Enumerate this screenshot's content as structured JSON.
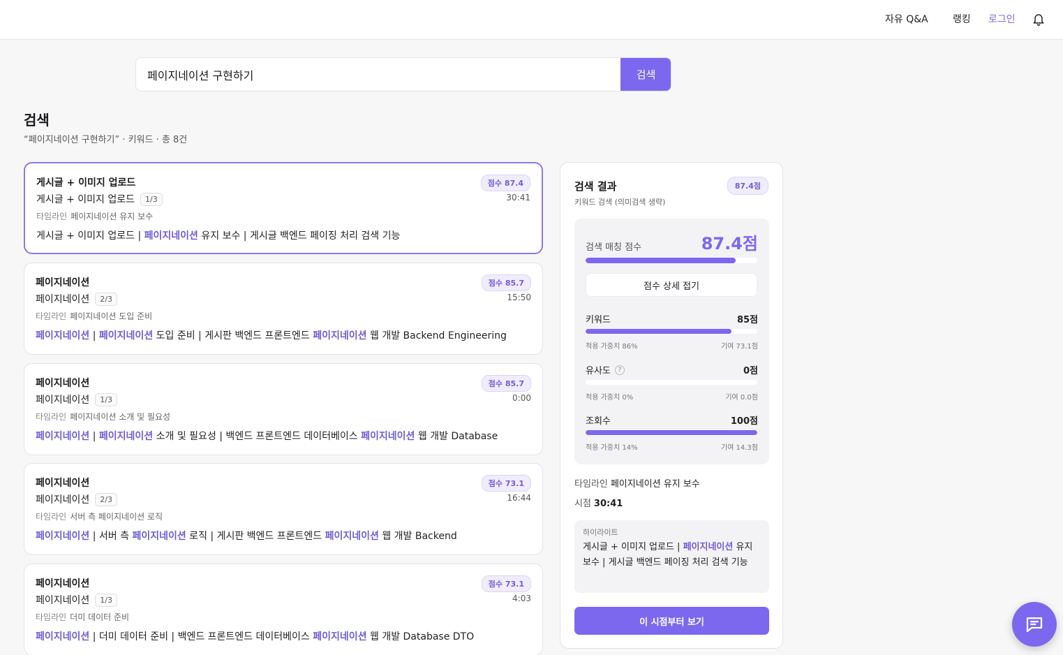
{
  "nav": {
    "items": [
      "자유 Q&A",
      "랭킹",
      "로그인"
    ],
    "active": "로그인",
    "bell_icon": "bell-icon"
  },
  "search": {
    "value": "페이지네이션 구현하기",
    "button_label": "검색"
  },
  "page": {
    "title": "검색",
    "subtitle": "“페이지네이션 구현하기” · 키워드  · 총 8건"
  },
  "results": [
    {
      "title": "게시글 + 이미지 업로드",
      "subtitle": "게시글 + 이미지 업로드",
      "part": "1/3",
      "timeline_label": "타임라인",
      "timeline": "페이지네이션 유지 보수",
      "score": "점수 87.4",
      "time": "30:41",
      "highlight": [
        {
          "t": "게시글 + 이미지 업로드 | ",
          "h": false
        },
        {
          "t": "페이지네이션",
          "h": true
        },
        {
          "t": " 유지 보수 | 게시글 백엔드 페이징 처리 검색 기능",
          "h": false
        }
      ]
    },
    {
      "title": "페이지네이션",
      "subtitle": "페이지네이션",
      "part": "2/3",
      "timeline_label": "타임라인",
      "timeline": "페이지네이션 도입 준비",
      "score": "점수 85.7",
      "time": "15:50",
      "highlight": [
        {
          "t": "페이지네이션",
          "h": true
        },
        {
          "t": " | ",
          "h": false
        },
        {
          "t": "페이지네이션",
          "h": true
        },
        {
          "t": " 도입 준비 | 게시판 백엔드 프론트엔드 ",
          "h": false
        },
        {
          "t": "페이지네이션",
          "h": true
        },
        {
          "t": " 웹 개발 Backend Engineering",
          "h": false
        }
      ]
    },
    {
      "title": "페이지네이션",
      "subtitle": "페이지네이션",
      "part": "1/3",
      "timeline_label": "타임라인",
      "timeline": "페이지네이션 소개 및 필요성",
      "score": "점수 85.7",
      "time": "0:00",
      "highlight": [
        {
          "t": "페이지네이션",
          "h": true
        },
        {
          "t": " | ",
          "h": false
        },
        {
          "t": "페이지네이션",
          "h": true
        },
        {
          "t": " 소개 및 필요성 | 백엔드 프론트엔드 데이터베이스 ",
          "h": false
        },
        {
          "t": "페이지네이션",
          "h": true
        },
        {
          "t": " 웹 개발 Database",
          "h": false
        }
      ]
    },
    {
      "title": "페이지네이션",
      "subtitle": "페이지네이션",
      "part": "2/3",
      "timeline_label": "타임라인",
      "timeline": "서버 측 페이지네이션 로직",
      "score": "점수 73.1",
      "time": "16:44",
      "highlight": [
        {
          "t": "페이지네이션",
          "h": true
        },
        {
          "t": " | 서버 측 ",
          "h": false
        },
        {
          "t": "페이지네이션",
          "h": true
        },
        {
          "t": " 로직 | 게시판 백엔드 프론트엔드 ",
          "h": false
        },
        {
          "t": "페이지네이션",
          "h": true
        },
        {
          "t": " 웹 개발 Backend",
          "h": false
        }
      ]
    },
    {
      "title": "페이지네이션",
      "subtitle": "페이지네이션",
      "part": "1/3",
      "timeline_label": "타임라인",
      "timeline": "더미 데이터 준비",
      "score": "점수 73.1",
      "time": "4:03",
      "highlight": [
        {
          "t": "페이지네이션",
          "h": true
        },
        {
          "t": " | 더미 데이터 준비 | 백엔드 프론트엔드 데이터베이스 ",
          "h": false
        },
        {
          "t": "페이지네이션",
          "h": true
        },
        {
          "t": " 웹 개발 Database DTO",
          "h": false
        }
      ]
    }
  ],
  "panel": {
    "title": "검색 결과",
    "subtitle": "키워드 검색 (의미검색 생략)",
    "badge": "87.4점",
    "match_label": "검색 매칭 점수",
    "match_value": "87.4점",
    "match_fraction": 0.874,
    "toggle_label": "점수 상세 접기",
    "metrics": [
      {
        "name": "키워드",
        "value": "85점",
        "fraction": 0.85,
        "weight": "적용 가중치 86%",
        "contrib": "기여 73.1점",
        "help": false
      },
      {
        "name": "유사도",
        "value": "0점",
        "fraction": 0,
        "weight": "적용 가중치 0%",
        "contrib": "기여 0.0점",
        "help": true
      },
      {
        "name": "조회수",
        "value": "100점",
        "fraction": 1.0,
        "weight": "적용 가중치 14%",
        "contrib": "기여 14.3점",
        "help": false
      }
    ],
    "timeline_label": "타임라인",
    "timeline_value": "페이지네이션 유지 보수",
    "time_label": "시점",
    "time_value": "30:41",
    "highlight_label": "하이라이트",
    "highlight": [
      {
        "t": "게시글 + 이미지 업로드 | ",
        "h": false
      },
      {
        "t": "페이지네이션",
        "h": true
      },
      {
        "t": " 유지 보수 | 게시글 백엔드 페이징 처리 검색 기능",
        "h": false
      }
    ],
    "cta_label": "이 시점부터 보기"
  },
  "fab": {
    "icon": "chat-icon"
  },
  "colors": {
    "accent": "#7b68ee",
    "accent_text": "#6d5ed6"
  }
}
